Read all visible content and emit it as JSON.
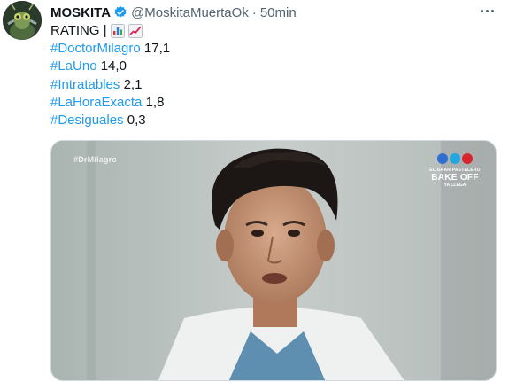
{
  "tweet": {
    "author_name": "MOSKITA",
    "handle": "@MoskitaMuertaOk",
    "separator": "·",
    "time": "50min",
    "text_intro": "RATING |",
    "ratings": [
      {
        "tag": "#DoctorMilagro",
        "value": "17,1"
      },
      {
        "tag": "#LaUno",
        "value": "14,0"
      },
      {
        "tag": "#Intratables",
        "value": "2,1"
      },
      {
        "tag": "#LaHoraExacta",
        "value": "1,8"
      },
      {
        "tag": "#Desiguales",
        "value": "0,3"
      }
    ]
  },
  "media": {
    "watermark_tag": "#DrMilagro",
    "logo_small": "EL GRAN PASTELERO",
    "logo_big": "BAKE OFF",
    "logo_sub": "YA LLEGA"
  },
  "colors": {
    "link": "#1d9bf0",
    "secondary_text": "#536471",
    "verified": "#1d9bf0",
    "logo_dots": [
      "#2f6fd0",
      "#22a8e0",
      "#d8262f"
    ]
  },
  "icons": {
    "verified": "verified-badge-icon",
    "more": "more-options-icon",
    "emoji_1": "bar-chart-emoji-icon",
    "emoji_2": "chart-increasing-emoji-icon"
  }
}
